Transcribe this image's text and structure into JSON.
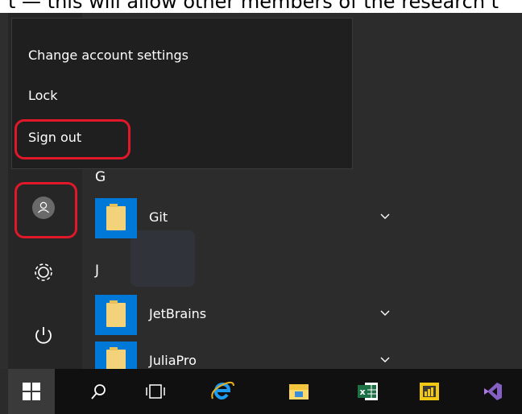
{
  "doc_strip_text": "t — this will allow other members of the research t",
  "account_menu": {
    "items": [
      "Change account settings",
      "Lock",
      "Sign out"
    ]
  },
  "sections": [
    "G",
    "J"
  ],
  "apps": [
    {
      "label": "Git"
    },
    {
      "label": "JetBrains"
    },
    {
      "label": "JuliaPro"
    }
  ],
  "left_rail": {
    "icons": [
      "user-avatar-icon",
      "gear-icon",
      "power-icon"
    ]
  },
  "taskbar": {
    "icons": [
      "windows-start-icon",
      "search-icon",
      "task-view-icon",
      "internet-explorer-icon",
      "file-explorer-icon",
      "excel-icon",
      "power-bi-icon",
      "visual-studio-icon"
    ]
  },
  "colors": {
    "tile_blue": "#0078d7",
    "highlight_red": "#e0182a",
    "popup_bg": "#1f1f1f",
    "taskbar_bg": "#101010"
  }
}
